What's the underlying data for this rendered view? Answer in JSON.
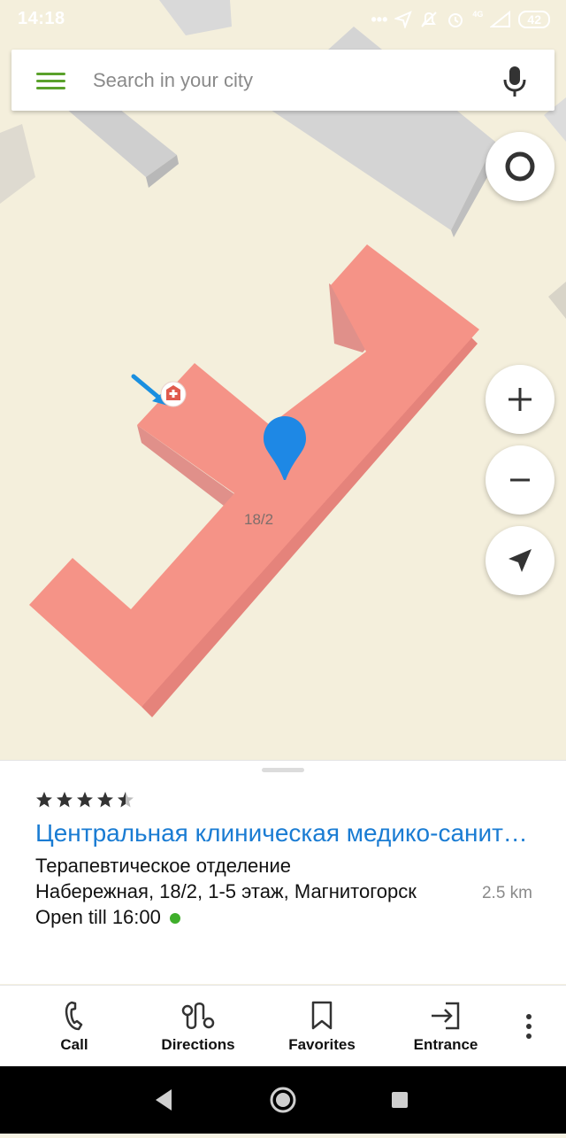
{
  "status_bar": {
    "time": "14:18",
    "battery": "42",
    "network": "4G"
  },
  "search": {
    "placeholder": "Search in your city"
  },
  "map": {
    "house_number": "18/2"
  },
  "place": {
    "rating": 4.5,
    "title": "Центральная клиническая медико-санитарная часть",
    "subtitle": "Терапевтическое отделение",
    "address": "Набережная, 18/2, 1-5 этаж, Магнитогорск",
    "distance": "2.5 km",
    "hours": "Open till 16:00"
  },
  "actions": [
    {
      "label": "Call",
      "icon": "phone-icon"
    },
    {
      "label": "Directions",
      "icon": "route-icon"
    },
    {
      "label": "Favorites",
      "icon": "bookmark-icon"
    },
    {
      "label": "Entrance",
      "icon": "entrance-icon"
    }
  ],
  "colors": {
    "accent_green": "#5aa12b",
    "link_blue": "#1a7cd3",
    "building": "#f4968a",
    "pin": "#1e88e5"
  }
}
